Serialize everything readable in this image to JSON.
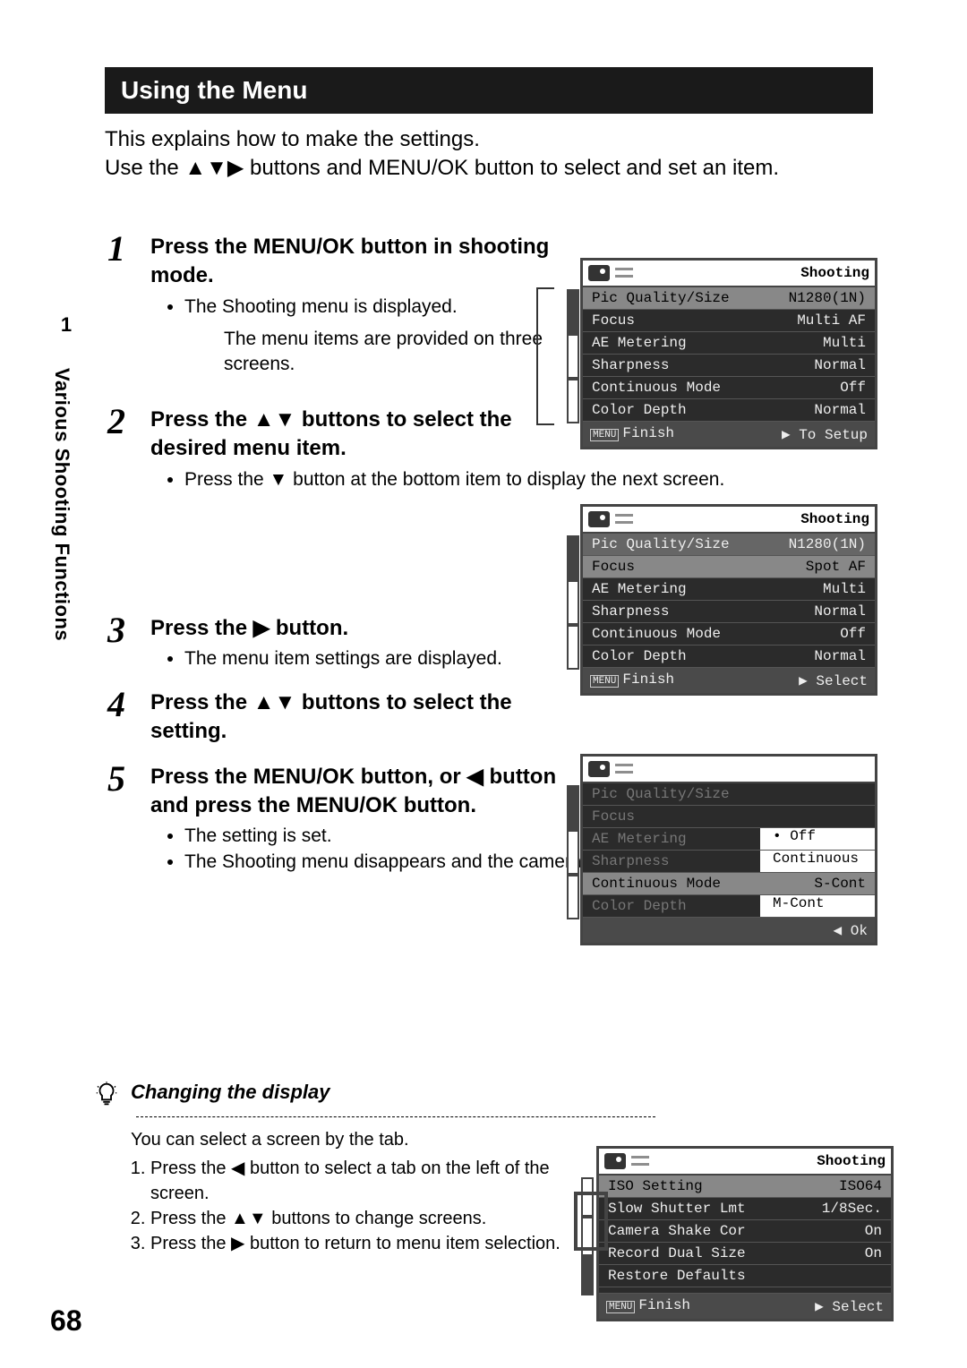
{
  "header": "Using the Menu",
  "intro_line1": "This explains how to make the settings.",
  "intro_line2a": "Use the ",
  "intro_line2b": " buttons and MENU/OK button to select and set an item.",
  "sidebar": {
    "chapter_num": "1",
    "chapter_title": "Various Shooting Functions"
  },
  "steps": [
    {
      "num": "1",
      "head": "Press the MENU/OK button in shooting mode.",
      "bullets": [
        "The Shooting menu is displayed."
      ],
      "note": "The menu items are provided on three screens."
    },
    {
      "num": "2",
      "head_a": "Press the ",
      "head_b": " buttons to select the desired menu item.",
      "bullets_a": "Press the ",
      "bullets_b": " button at the bottom item to display the next screen."
    },
    {
      "num": "3",
      "head_a": "Press the ",
      "head_b": " button.",
      "bullets": [
        "The menu item settings are displayed."
      ]
    },
    {
      "num": "4",
      "head_a": "Press the ",
      "head_b": " buttons to select the setting."
    },
    {
      "num": "5",
      "head_a": "Press the MENU/OK button, or ",
      "head_b": " button and press the MENU/OK button.",
      "bullets": [
        "The setting is set.",
        "The Shooting menu disappears and the camera is ready to shoot."
      ]
    }
  ],
  "tip": {
    "title": "Changing the display",
    "intro": "You can select a screen by the tab.",
    "items": [
      {
        "a": "Press the ",
        "b": " button to select a tab on the left of the screen."
      },
      {
        "a": "Press the ",
        "b": " buttons to change screens."
      },
      {
        "a": "Press the ",
        "b": " button to return to menu item selection."
      }
    ]
  },
  "screens": {
    "s1": {
      "title": "Shooting",
      "rows": [
        {
          "k": "Pic Quality/Size",
          "v": "N1280(1N)",
          "sel": true
        },
        {
          "k": "Focus",
          "v": "Multi AF"
        },
        {
          "k": "AE Metering",
          "v": "Multi"
        },
        {
          "k": "Sharpness",
          "v": "Normal"
        },
        {
          "k": "Continuous Mode",
          "v": "Off"
        },
        {
          "k": "Color Depth",
          "v": "Normal"
        }
      ],
      "foot_l": "Finish",
      "foot_r": "To Setup",
      "menu": "MENU",
      "arrow": "▶"
    },
    "s2": {
      "title": "Shooting",
      "rows": [
        {
          "k": "Pic Quality/Size",
          "v": "N1280(1N)",
          "hi": true
        },
        {
          "k": "Focus",
          "v": "Spot AF",
          "sel": true
        },
        {
          "k": "AE Metering",
          "v": "Multi"
        },
        {
          "k": "Sharpness",
          "v": "Normal"
        },
        {
          "k": "Continuous Mode",
          "v": "Off"
        },
        {
          "k": "Color Depth",
          "v": "Normal"
        }
      ],
      "foot_l": "Finish",
      "foot_r": "Select",
      "menu": "MENU",
      "arrow": "▶"
    },
    "s3": {
      "title": "",
      "rows": [
        {
          "k": "Pic Quality/Size",
          "v": "",
          "dim": true
        },
        {
          "k": "Focus",
          "v": "",
          "dim": true
        },
        {
          "k": "AE Metering",
          "v": "• Off",
          "dim": true,
          "vwhite": true
        },
        {
          "k": "Sharpness",
          "v": "Continuous",
          "dim": true,
          "vwhite": true
        },
        {
          "k": "Continuous Mode",
          "v": "S-Cont",
          "sel": true
        },
        {
          "k": "Color Depth",
          "v": "M-Cont",
          "dim": true,
          "vwhite": true
        }
      ],
      "foot_l": "",
      "foot_r": "Ok",
      "menu": "",
      "arrow": "◀"
    },
    "s4": {
      "title": "Shooting",
      "rows": [
        {
          "k": "ISO Setting",
          "v": "ISO64",
          "sel": true
        },
        {
          "k": "Slow Shutter Lmt",
          "v": "1/8Sec."
        },
        {
          "k": "Camera Shake Cor",
          "v": "On"
        },
        {
          "k": "Record Dual Size",
          "v": "On"
        },
        {
          "k": "Restore Defaults",
          "v": ""
        },
        {
          "k": "",
          "v": ""
        }
      ],
      "foot_l": "Finish",
      "foot_r": "Select",
      "menu": "MENU",
      "arrow": "▶"
    }
  },
  "page_number": "68"
}
